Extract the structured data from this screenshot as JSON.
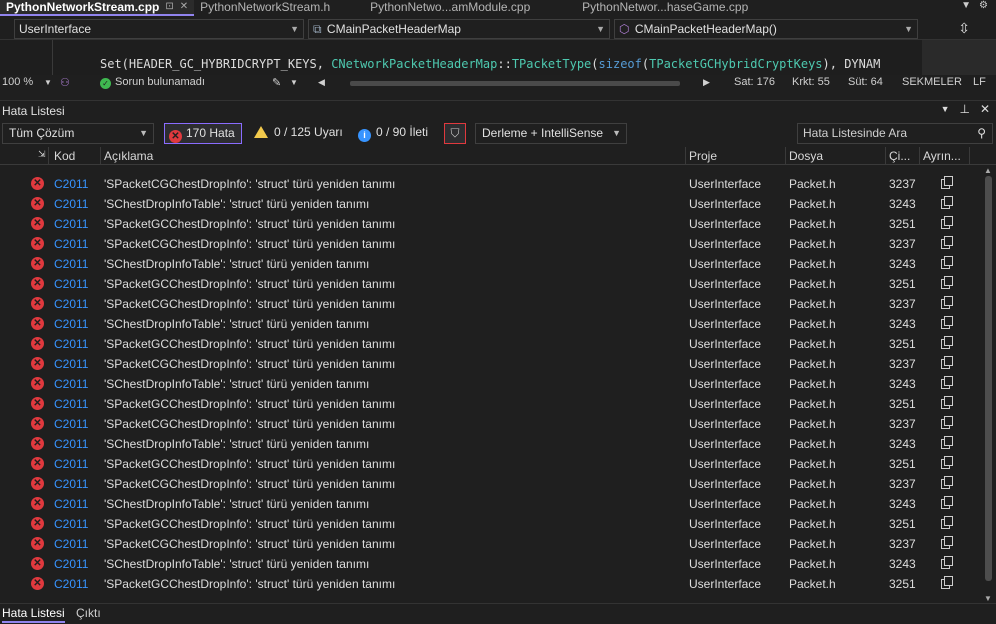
{
  "tabs": [
    {
      "label": "PythonNetworkStream.cpp",
      "active": true
    },
    {
      "label": "PythonNetworkStream.h",
      "active": false
    },
    {
      "label": "PythonNetwo...amModule.cpp",
      "active": false
    },
    {
      "label": "PythonNetwor...haseGame.cpp",
      "active": false
    }
  ],
  "navbar": {
    "project": "UserInterface",
    "scope": "CMainPacketHeaderMap",
    "member": "CMainPacketHeaderMap()"
  },
  "code": {
    "line_parts": [
      "Set(HEADER_GC_HYBRIDCRYPT_KEYS, ",
      "CNetworkPacketHeaderMap",
      "::",
      "TPacketType",
      "(",
      "sizeof",
      "(",
      "TPacketGCHybridCryptKeys",
      "), DYNAM"
    ]
  },
  "statusbar": {
    "zoom": "100 %",
    "issues": "Sorun bulunamadı",
    "line": "Sat: 176",
    "col": "Krkt: 55",
    "pos": "Süt: 64",
    "tabs": "SEKMELER",
    "eol": "LF"
  },
  "panel": {
    "title": "Hata Listesi"
  },
  "toolbar": {
    "scope": "Tüm Çözüm",
    "errors": "170 Hata",
    "warnings": "0 / 125 Uyarı",
    "messages": "0 / 90 İleti",
    "source": "Derleme + IntelliSense",
    "search_placeholder": "Hata Listesinde Ara"
  },
  "columns": {
    "code": "Kod",
    "description": "Açıklama",
    "project": "Proje",
    "file": "Dosya",
    "line": "Çi...",
    "details": "Ayrın..."
  },
  "rows": [
    {
      "code": "C2011",
      "desc": "'SPacketCGChestDropInfo': 'struct' türü yeniden tanımı",
      "project": "UserInterface",
      "file": "Packet.h",
      "line": "3237"
    },
    {
      "code": "C2011",
      "desc": "'SChestDropInfoTable': 'struct' türü yeniden tanımı",
      "project": "UserInterface",
      "file": "Packet.h",
      "line": "3243"
    },
    {
      "code": "C2011",
      "desc": "'SPacketGCChestDropInfo': 'struct' türü yeniden tanımı",
      "project": "UserInterface",
      "file": "Packet.h",
      "line": "3251"
    },
    {
      "code": "C2011",
      "desc": "'SPacketCGChestDropInfo': 'struct' türü yeniden tanımı",
      "project": "UserInterface",
      "file": "Packet.h",
      "line": "3237"
    },
    {
      "code": "C2011",
      "desc": "'SChestDropInfoTable': 'struct' türü yeniden tanımı",
      "project": "UserInterface",
      "file": "Packet.h",
      "line": "3243"
    },
    {
      "code": "C2011",
      "desc": "'SPacketGCChestDropInfo': 'struct' türü yeniden tanımı",
      "project": "UserInterface",
      "file": "Packet.h",
      "line": "3251"
    },
    {
      "code": "C2011",
      "desc": "'SPacketCGChestDropInfo': 'struct' türü yeniden tanımı",
      "project": "UserInterface",
      "file": "Packet.h",
      "line": "3237"
    },
    {
      "code": "C2011",
      "desc": "'SChestDropInfoTable': 'struct' türü yeniden tanımı",
      "project": "UserInterface",
      "file": "Packet.h",
      "line": "3243"
    },
    {
      "code": "C2011",
      "desc": "'SPacketGCChestDropInfo': 'struct' türü yeniden tanımı",
      "project": "UserInterface",
      "file": "Packet.h",
      "line": "3251"
    },
    {
      "code": "C2011",
      "desc": "'SPacketCGChestDropInfo': 'struct' türü yeniden tanımı",
      "project": "UserInterface",
      "file": "Packet.h",
      "line": "3237"
    },
    {
      "code": "C2011",
      "desc": "'SChestDropInfoTable': 'struct' türü yeniden tanımı",
      "project": "UserInterface",
      "file": "Packet.h",
      "line": "3243"
    },
    {
      "code": "C2011",
      "desc": "'SPacketGCChestDropInfo': 'struct' türü yeniden tanımı",
      "project": "UserInterface",
      "file": "Packet.h",
      "line": "3251"
    },
    {
      "code": "C2011",
      "desc": "'SPacketCGChestDropInfo': 'struct' türü yeniden tanımı",
      "project": "UserInterface",
      "file": "Packet.h",
      "line": "3237"
    },
    {
      "code": "C2011",
      "desc": "'SChestDropInfoTable': 'struct' türü yeniden tanımı",
      "project": "UserInterface",
      "file": "Packet.h",
      "line": "3243"
    },
    {
      "code": "C2011",
      "desc": "'SPacketGCChestDropInfo': 'struct' türü yeniden tanımı",
      "project": "UserInterface",
      "file": "Packet.h",
      "line": "3251"
    },
    {
      "code": "C2011",
      "desc": "'SPacketCGChestDropInfo': 'struct' türü yeniden tanımı",
      "project": "UserInterface",
      "file": "Packet.h",
      "line": "3237"
    },
    {
      "code": "C2011",
      "desc": "'SChestDropInfoTable': 'struct' türü yeniden tanımı",
      "project": "UserInterface",
      "file": "Packet.h",
      "line": "3243"
    },
    {
      "code": "C2011",
      "desc": "'SPacketGCChestDropInfo': 'struct' türü yeniden tanımı",
      "project": "UserInterface",
      "file": "Packet.h",
      "line": "3251"
    },
    {
      "code": "C2011",
      "desc": "'SPacketCGChestDropInfo': 'struct' türü yeniden tanımı",
      "project": "UserInterface",
      "file": "Packet.h",
      "line": "3237"
    },
    {
      "code": "C2011",
      "desc": "'SChestDropInfoTable': 'struct' türü yeniden tanımı",
      "project": "UserInterface",
      "file": "Packet.h",
      "line": "3243"
    },
    {
      "code": "C2011",
      "desc": "'SPacketGCChestDropInfo': 'struct' türü yeniden tanımı",
      "project": "UserInterface",
      "file": "Packet.h",
      "line": "3251"
    }
  ],
  "bottom_tabs": [
    "Hata Listesi",
    "Çıktı"
  ],
  "colors": {
    "error": "#e0393e",
    "accent": "#9184ee",
    "link": "#3794ff",
    "warning": "#f2c94c"
  }
}
